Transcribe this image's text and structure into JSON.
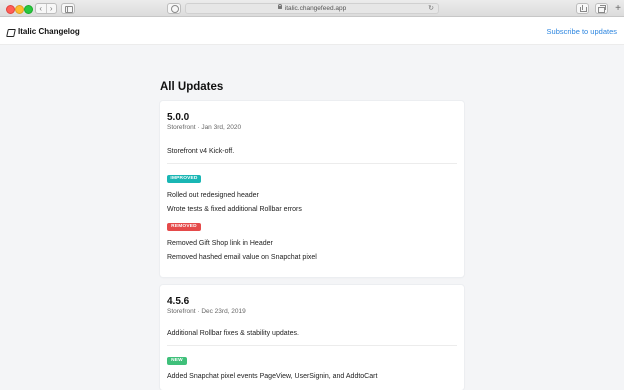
{
  "browser": {
    "url": "italic.changefeed.app",
    "nav_back": "‹",
    "nav_forward": "›",
    "reload": "↻",
    "new_tab": "+"
  },
  "header": {
    "app_name": "Italic Changelog",
    "subscribe_link": "Subscribe to updates"
  },
  "main": {
    "page_title": "All Updates",
    "releases": [
      {
        "version": "5.0.0",
        "meta": "Storefront · Jan 3rd, 2020",
        "summary": "Storefront v4 Kick-off.",
        "groups": [
          {
            "badge": "IMPROVED",
            "items": [
              "Rolled out redesigned header",
              "Wrote tests & fixed additional Rollbar errors"
            ]
          },
          {
            "badge": "REMOVED",
            "items": [
              "Removed Gift Shop link in Header",
              "Removed hashed email value on Snapchat pixel"
            ]
          }
        ]
      },
      {
        "version": "4.5.6",
        "meta": "Storefront · Dec 23rd, 2019",
        "summary": "Additional Rollbar fixes & stability updates.",
        "groups": [
          {
            "badge": "NEW",
            "items": [
              "Added Snapchat pixel events PageView, UserSignin, and AddtoCart"
            ]
          }
        ]
      }
    ]
  },
  "colors": {
    "accent": "#2d86e0",
    "improved": "#19b6b4",
    "removed": "#e54a4a",
    "new": "#3fc07a",
    "background": "#f4f5f7"
  }
}
